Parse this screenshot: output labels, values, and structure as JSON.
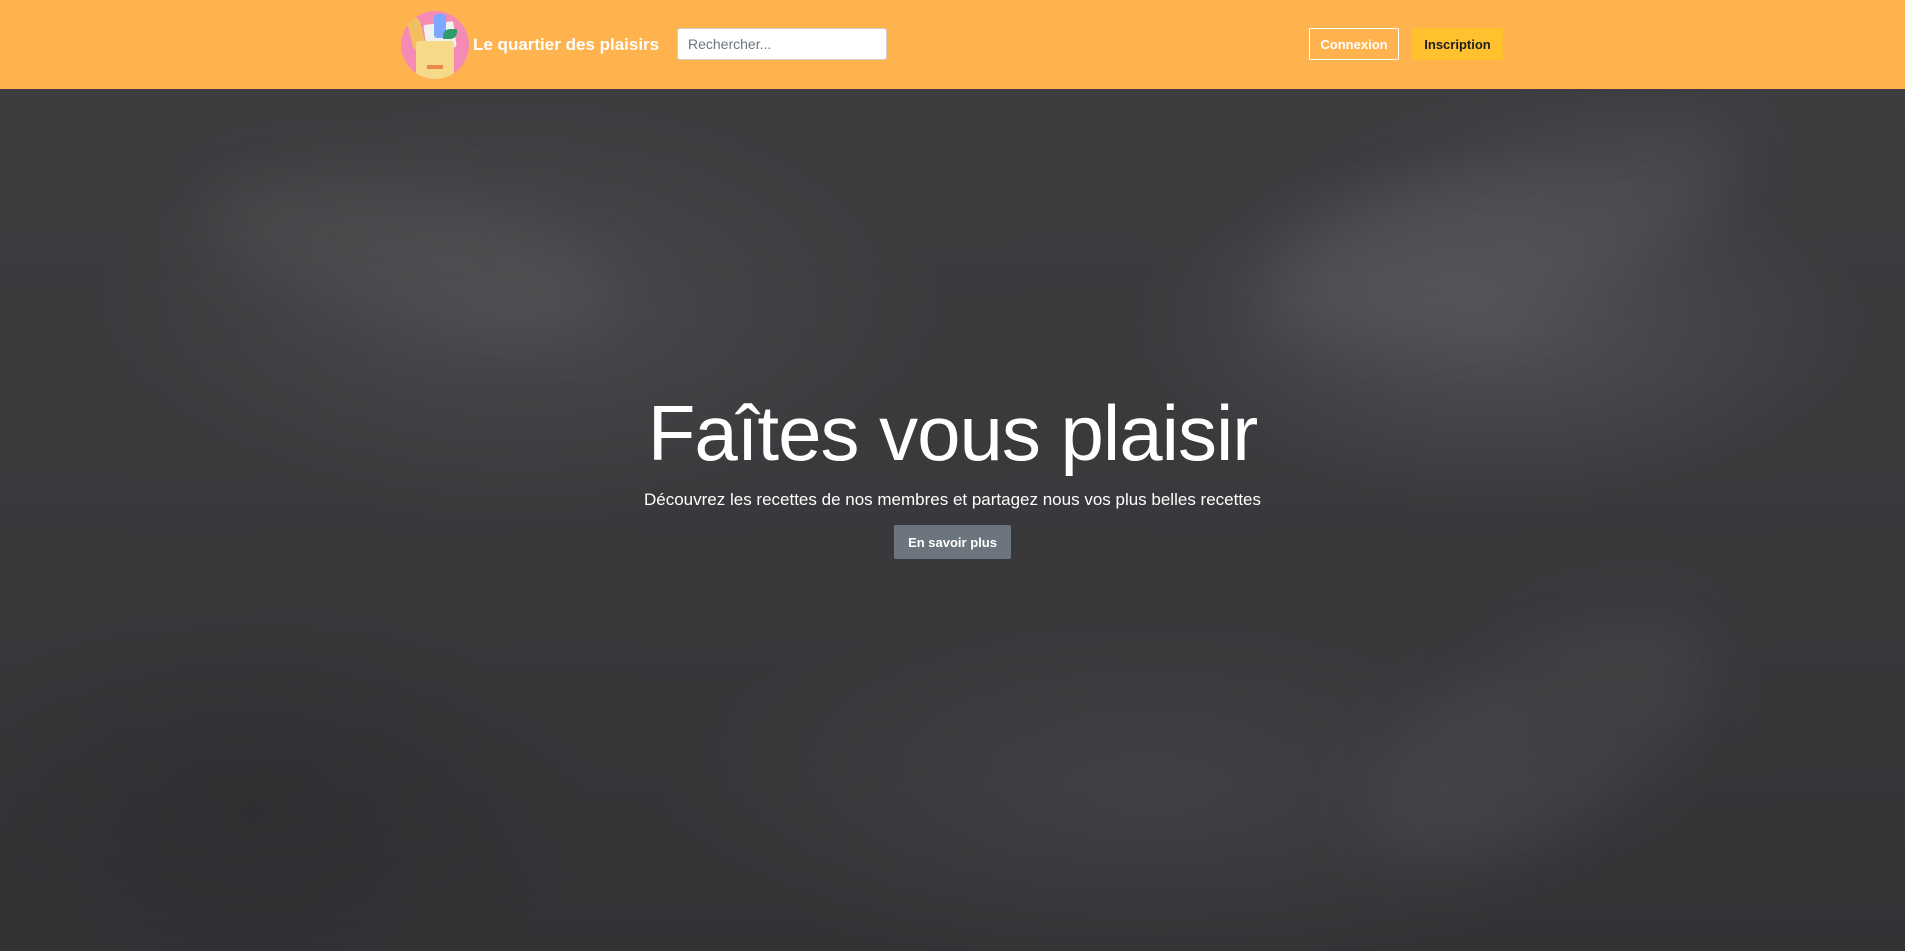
{
  "navbar": {
    "brand_name": "Le quartier des plaisirs",
    "logo_icon": "grocery-bag-logo-icon",
    "search_placeholder": "Rechercher...",
    "search_value": "",
    "login_label": "Connexion",
    "signup_label": "Inscription",
    "colors": {
      "background": "#ffb34f",
      "signup_button": "#ffc12e"
    }
  },
  "hero": {
    "title": "Faîtes vous plaisir",
    "subtitle": "Découvrez les recettes de nos membres et partagez nous vos plus belles recettes",
    "cta_label": "En savoir plus",
    "background": "chalkboard",
    "colors": {
      "cta_button": "#6c757d"
    }
  }
}
